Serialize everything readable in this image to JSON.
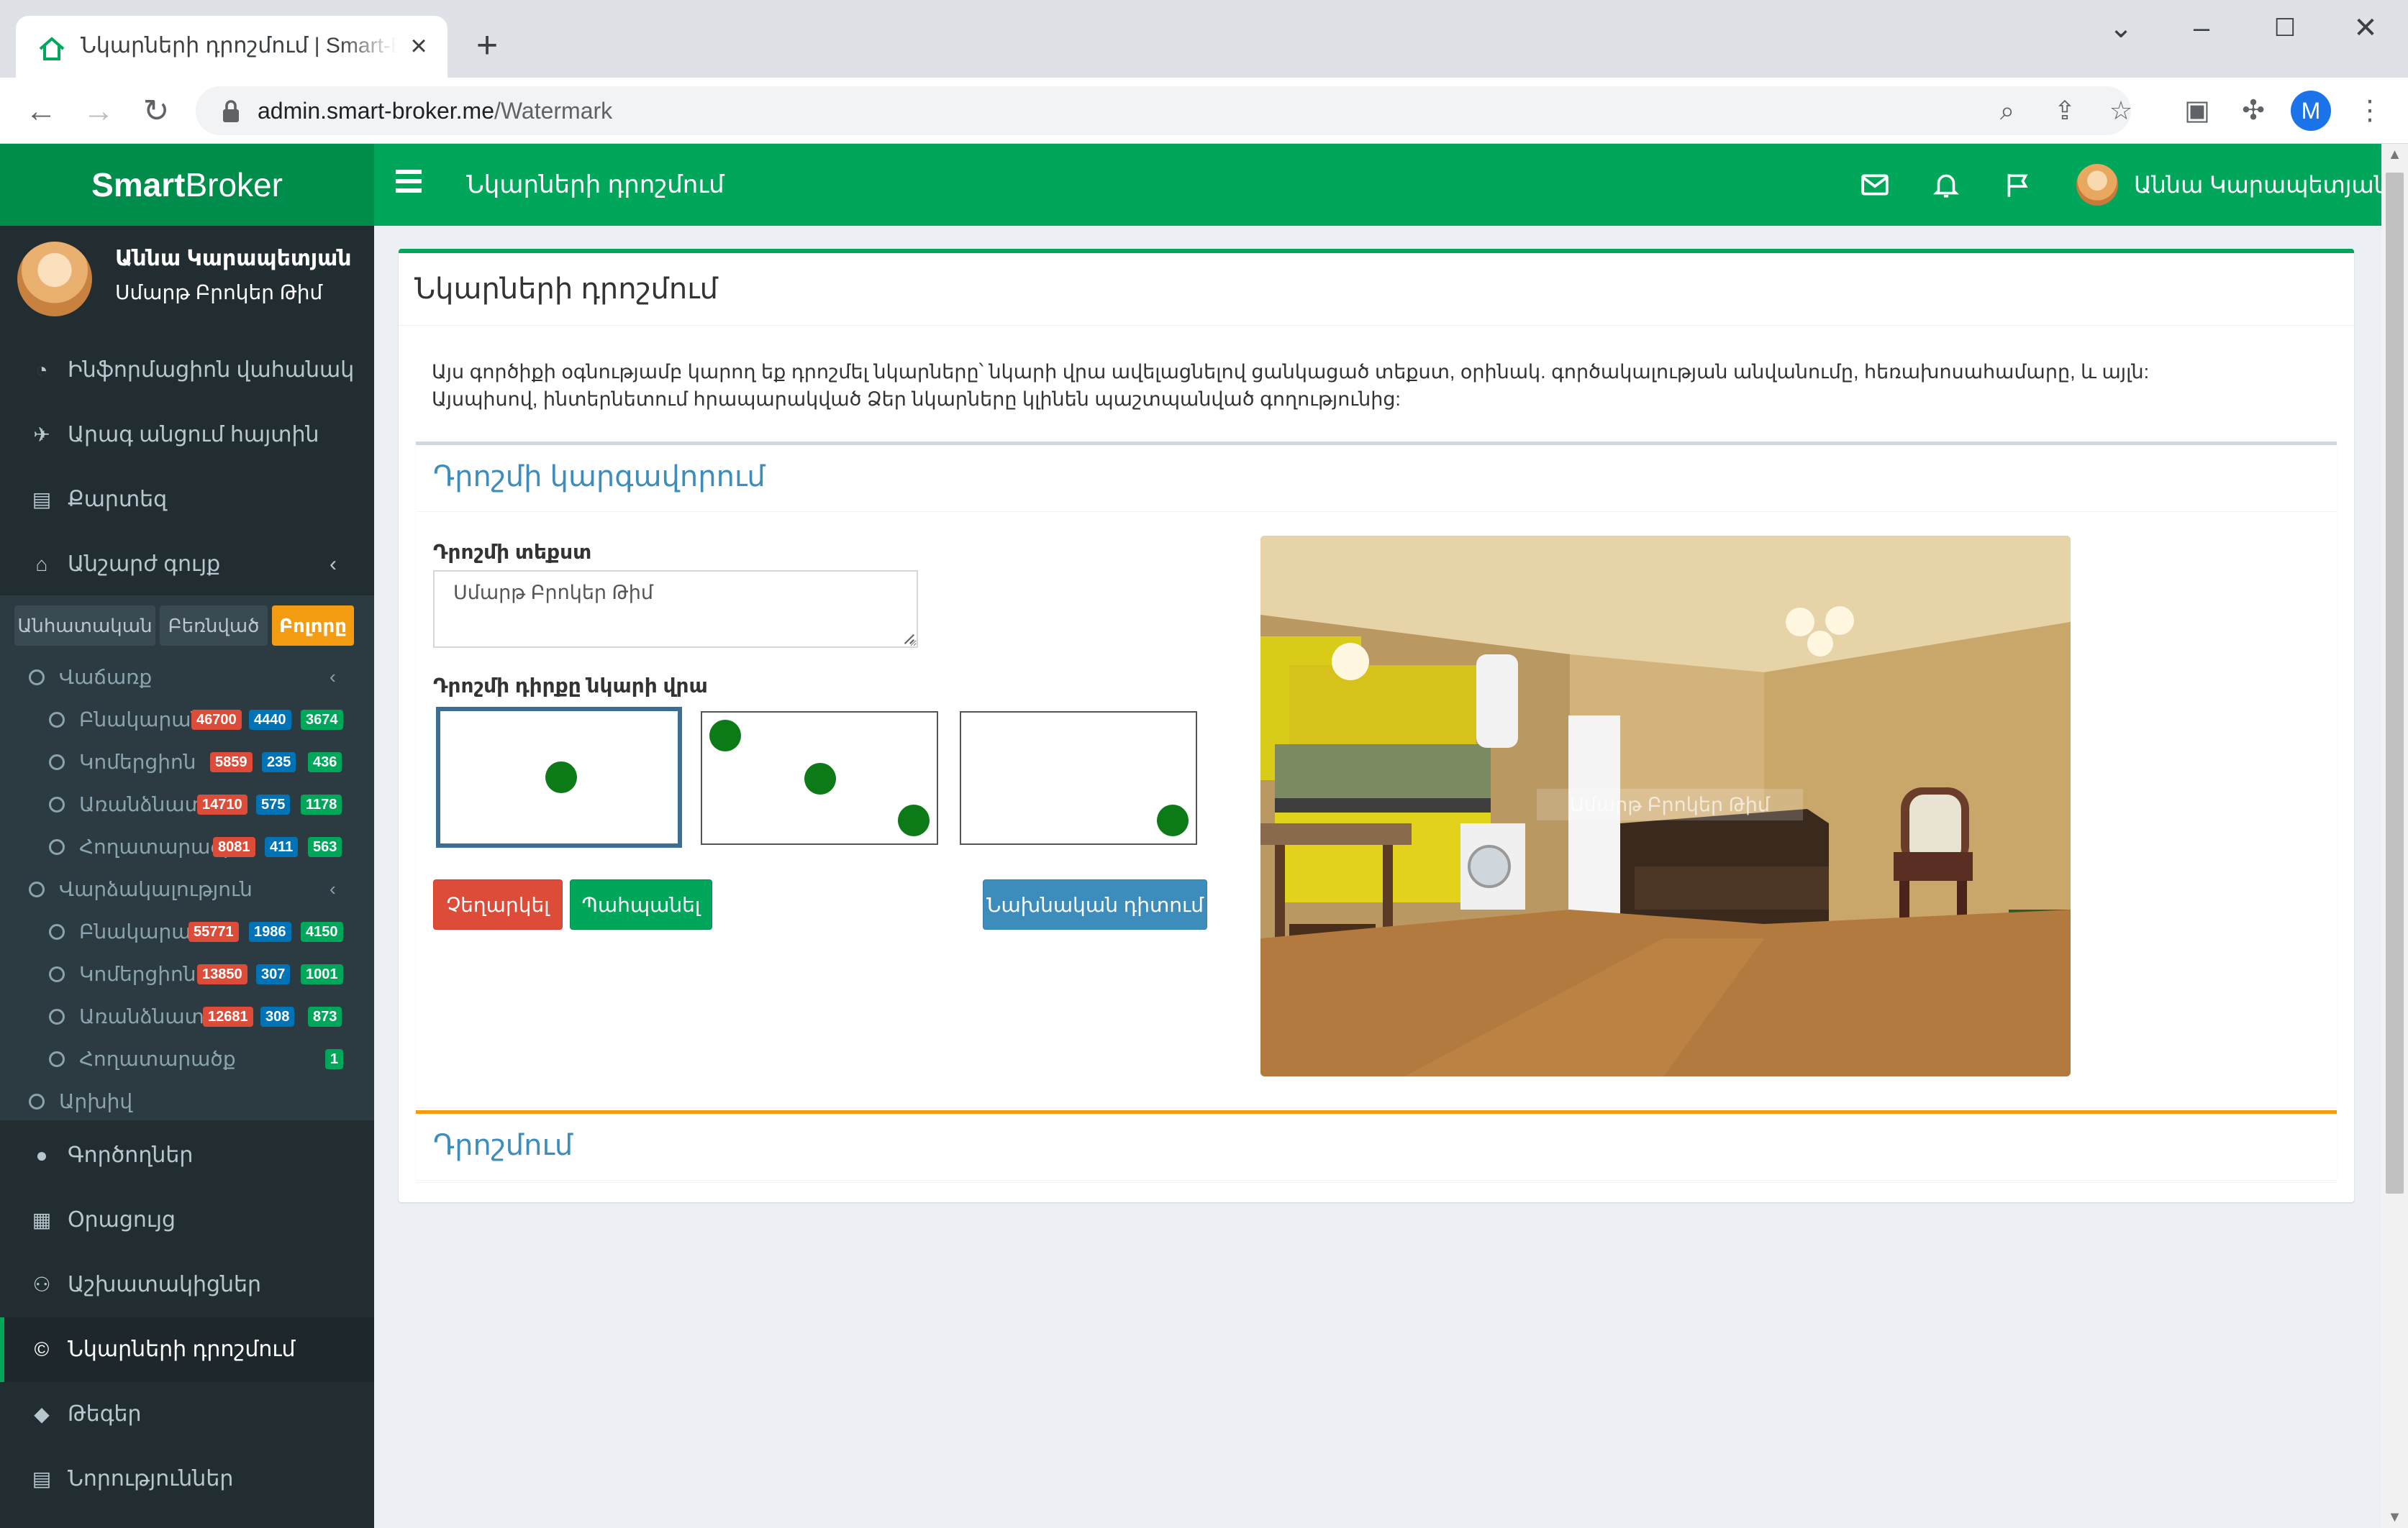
{
  "browser": {
    "tab_title": "Նկարների դրոշմում | Smart-Broker",
    "url_host": "admin.smart-broker.me",
    "url_path": "/Watermark",
    "profile_initial": "M"
  },
  "header": {
    "logo_bold": "Smart",
    "logo_light": "Broker",
    "title": "Նկարների դրոշմում",
    "user_name": "Աննա Կարապետյան"
  },
  "sidebar": {
    "user_name": "Աննա Կարապետյան",
    "user_role": "Սմարթ Բրոկեր Թիմ",
    "items_top": [
      {
        "label": "Ինֆորմացիոն վահանակ",
        "icon": "dashboard-icon"
      },
      {
        "label": "Արագ անցում հայտին",
        "icon": "plane-icon"
      },
      {
        "label": "Քարտեզ",
        "icon": "map-icon"
      },
      {
        "label": "Անշարժ գույք",
        "icon": "home-icon"
      }
    ],
    "filter_tabs": [
      "Անհատական",
      "Բեռնված",
      "Բոլորը"
    ],
    "tree": {
      "sale": {
        "label": "Վաճառք",
        "rows": [
          {
            "label": "Բնակարան",
            "b1": "46700",
            "b2": "4440",
            "b3": "3674"
          },
          {
            "label": "Կոմերցիոն",
            "b1": "5859",
            "b2": "235",
            "b3": "436"
          },
          {
            "label": "Առանձնատուն",
            "b1": "14710",
            "b2": "575",
            "b3": "1178"
          },
          {
            "label": "Հողատարածք",
            "b1": "8081",
            "b2": "411",
            "b3": "563"
          }
        ]
      },
      "rent": {
        "label": "Վարձակալություն",
        "rows": [
          {
            "label": "Բնակարան",
            "b1": "55771",
            "b2": "1986",
            "b3": "4150"
          },
          {
            "label": "Կոմերցիոն",
            "b1": "13850",
            "b2": "307",
            "b3": "1001"
          },
          {
            "label": "Առանձնատուն",
            "b1": "12681",
            "b2": "308",
            "b3": "873"
          },
          {
            "label": "Հողատարածք",
            "b3": "1"
          }
        ]
      },
      "archive": "Արխիվ"
    },
    "items_bottom": [
      {
        "label": "Գործողներ",
        "icon": "user-icon"
      },
      {
        "label": "Օրացույց",
        "icon": "calendar-icon"
      },
      {
        "label": "Աշխատակիցներ",
        "icon": "users-icon"
      },
      {
        "label": "Նկարների դրոշմում",
        "icon": "copyright-icon"
      },
      {
        "label": "Թեգեր",
        "icon": "tags-icon"
      },
      {
        "label": "Նորություններ",
        "icon": "newspaper-icon"
      }
    ]
  },
  "main": {
    "box_title": "Նկարների դրոշմում",
    "description_line1": "Այս գործիքի օգնությամբ կարող եք դրոշմել նկարները՝ նկարի վրա ավելացնելով ցանկացած տեքստ, օրինակ. գործակալության անվանումը, հեռախոսահամարը, և այլն:",
    "description_line2": "Այսպիսով, ինտերնետում հրապարակված Ձեր նկարները կլինեն պաշտպանված գողությունից:",
    "settings_title": "Դրոշմի կարգավորում",
    "text_label": "Դրոշմի տեքստ",
    "text_value": "Սմարթ Բրոկեր Թիմ",
    "position_label": "Դրոշմի դիրքը նկարի վրա",
    "positions": [
      "center",
      "diagonal",
      "bottom-right"
    ],
    "selected_position": "center",
    "btn_cancel": "Չեղարկել",
    "btn_save": "Պահպանել",
    "btn_preview": "Նախնական դիտում",
    "watermark_preview_text": "Սմարթ Բրոկեր Թիմ",
    "watermark_title": "Դրոշմում"
  }
}
